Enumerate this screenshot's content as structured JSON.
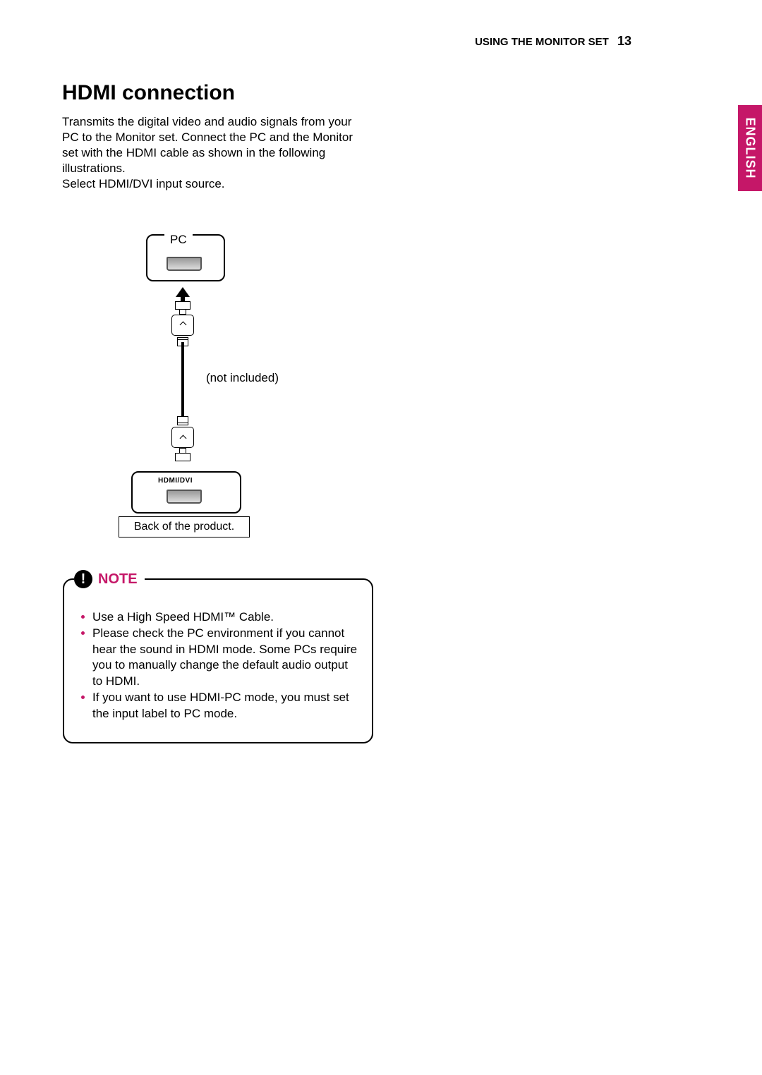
{
  "header": {
    "section": "USING THE MONITOR SET",
    "page": "13"
  },
  "language": "ENGLISH",
  "title": "HDMI connection",
  "intro": "Transmits the digital video and audio signals from your PC to the Monitor set. Connect the PC and the Monitor set with the HDMI cable as shown in the following illustrations.\nSelect HDMI/DVI input source.",
  "diagram": {
    "pc_label": "PC",
    "cable_note": "(not included)",
    "port_label": "HDMI/DVI",
    "back_label": "Back of the product."
  },
  "note": {
    "heading": "NOTE",
    "items": [
      "Use a High Speed HDMI™ Cable.",
      "Please check the PC environment if you cannot hear the sound in HDMI mode. Some PCs require you to manually change the default audio output to HDMI.",
      "If you want to use HDMI-PC mode, you must set the input label to PC mode."
    ]
  }
}
